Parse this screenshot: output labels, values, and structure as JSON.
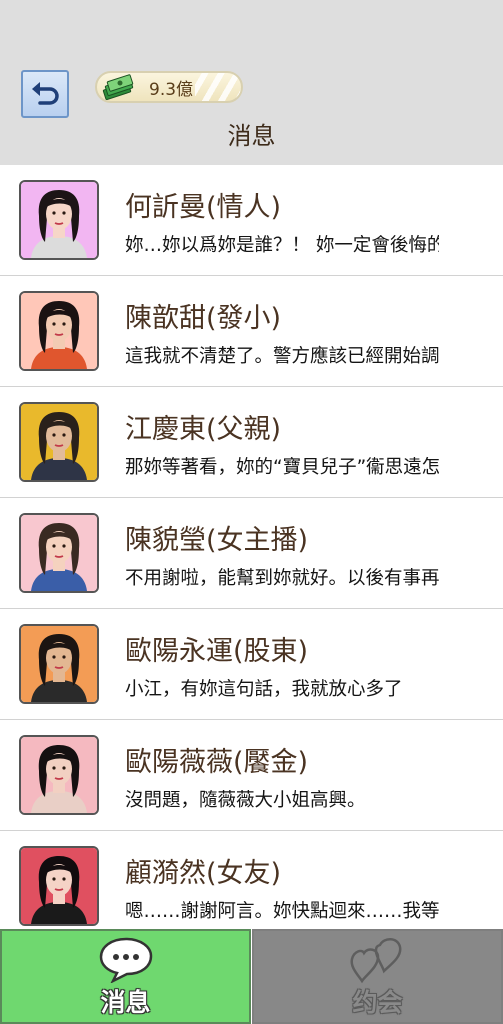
{
  "header": {
    "title": "消息",
    "money": "9.3億",
    "back_icon": "back-arrow-icon"
  },
  "contacts": [
    {
      "name": "何訢曼(情人)",
      "message": "妳…妳以爲妳是誰？！ 妳一定會後悔的",
      "bg": "#f2b6f2",
      "hair": "#1c1416",
      "skin": "#f6d6c8",
      "shirt": "#dcdcdc"
    },
    {
      "name": "陳歆甜(發小)",
      "message": "這我就不清楚了。警方應該已經開始調查了",
      "bg": "#ffc7b8",
      "hair": "#1a1212",
      "skin": "#f3cbb3",
      "shirt": "#e0562e"
    },
    {
      "name": "江慶東(父親)",
      "message": "那妳等著看，妳的“寶貝兒子”衞思遠怎麼辦",
      "bg": "#e9b92c",
      "hair": "#2a211b",
      "skin": "#e2bb9a",
      "shirt": "#2e3446"
    },
    {
      "name": "陳貌瑩(女主播)",
      "message": "不用謝啦，能幫到妳就好。以後有事再找我",
      "bg": "#f8c7cf",
      "hair": "#3a2a22",
      "skin": "#f5d2bf",
      "shirt": "#3a5ea8"
    },
    {
      "name": "歐陽永運(股東)",
      "message": "小江，有妳這句話，我就放心多了",
      "bg": "#f39c55",
      "hair": "#1c1512",
      "skin": "#e3b792",
      "shirt": "#2a2a2a"
    },
    {
      "name": "歐陽薇薇(饜金)",
      "message": "沒問題，隨薇薇大小姐高興。",
      "bg": "#f5b9c0",
      "hair": "#151011",
      "skin": "#f2d0c2",
      "shirt": "#e9cfc6"
    },
    {
      "name": "顧漪然(女友)",
      "message": "嗯……謝謝阿言。妳快點迴來……我等妳",
      "bg": "#e05060",
      "hair": "#120c0e",
      "skin": "#f5d3c6",
      "shirt": "#1a1a1a"
    }
  ],
  "tabs": [
    {
      "label": "消息",
      "icon": "chat-bubble-icon",
      "active": true
    },
    {
      "label": "约会",
      "icon": "hearts-icon",
      "active": false
    }
  ]
}
